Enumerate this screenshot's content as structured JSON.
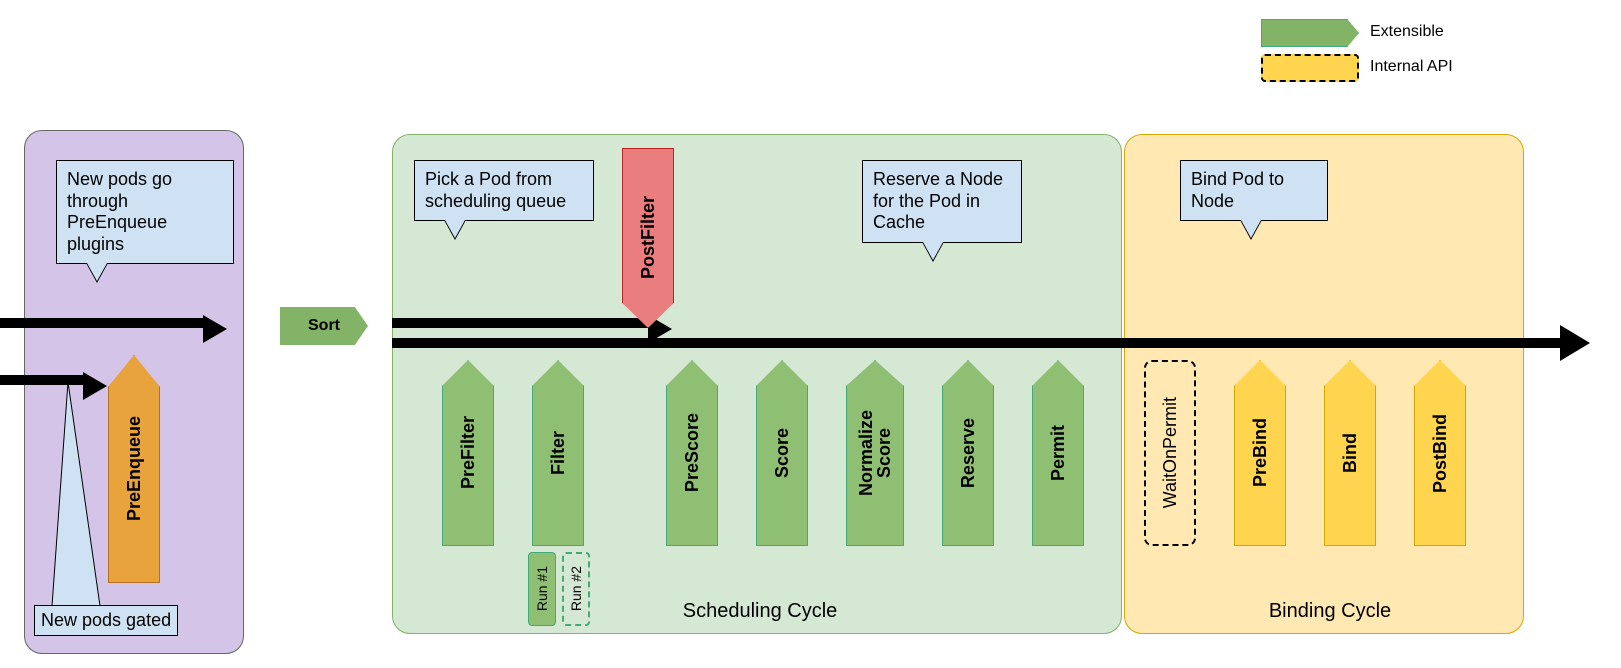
{
  "legend": {
    "extensible_label": "Extensible",
    "internal_label": "Internal API"
  },
  "purple": {
    "callout_newpods": "New pods go through PreEnqueue plugins",
    "preenqueue": "PreEnqueue",
    "gated": "New pods gated"
  },
  "sort": "Sort",
  "scheduling": {
    "pick_pod": "Pick a Pod from scheduling queue",
    "postfilter": "PostFilter",
    "reserve_node": "Reserve a Node for the Pod in Cache",
    "prefilter": "PreFilter",
    "filter": "Filter",
    "prescore": "PreScore",
    "score": "Score",
    "normalize": "Normalize\nScore",
    "reserve": "Reserve",
    "permit": "Permit",
    "run1": "Run #1",
    "run2": "Run #2",
    "cycle_label": "Scheduling Cycle"
  },
  "binding": {
    "bind_pod": "Bind Pod to Node",
    "waitonpermit": "WaitOnPermit",
    "prebind": "PreBind",
    "bind": "Bind",
    "postbind": "PostBind",
    "cycle_label": "Binding Cycle"
  }
}
